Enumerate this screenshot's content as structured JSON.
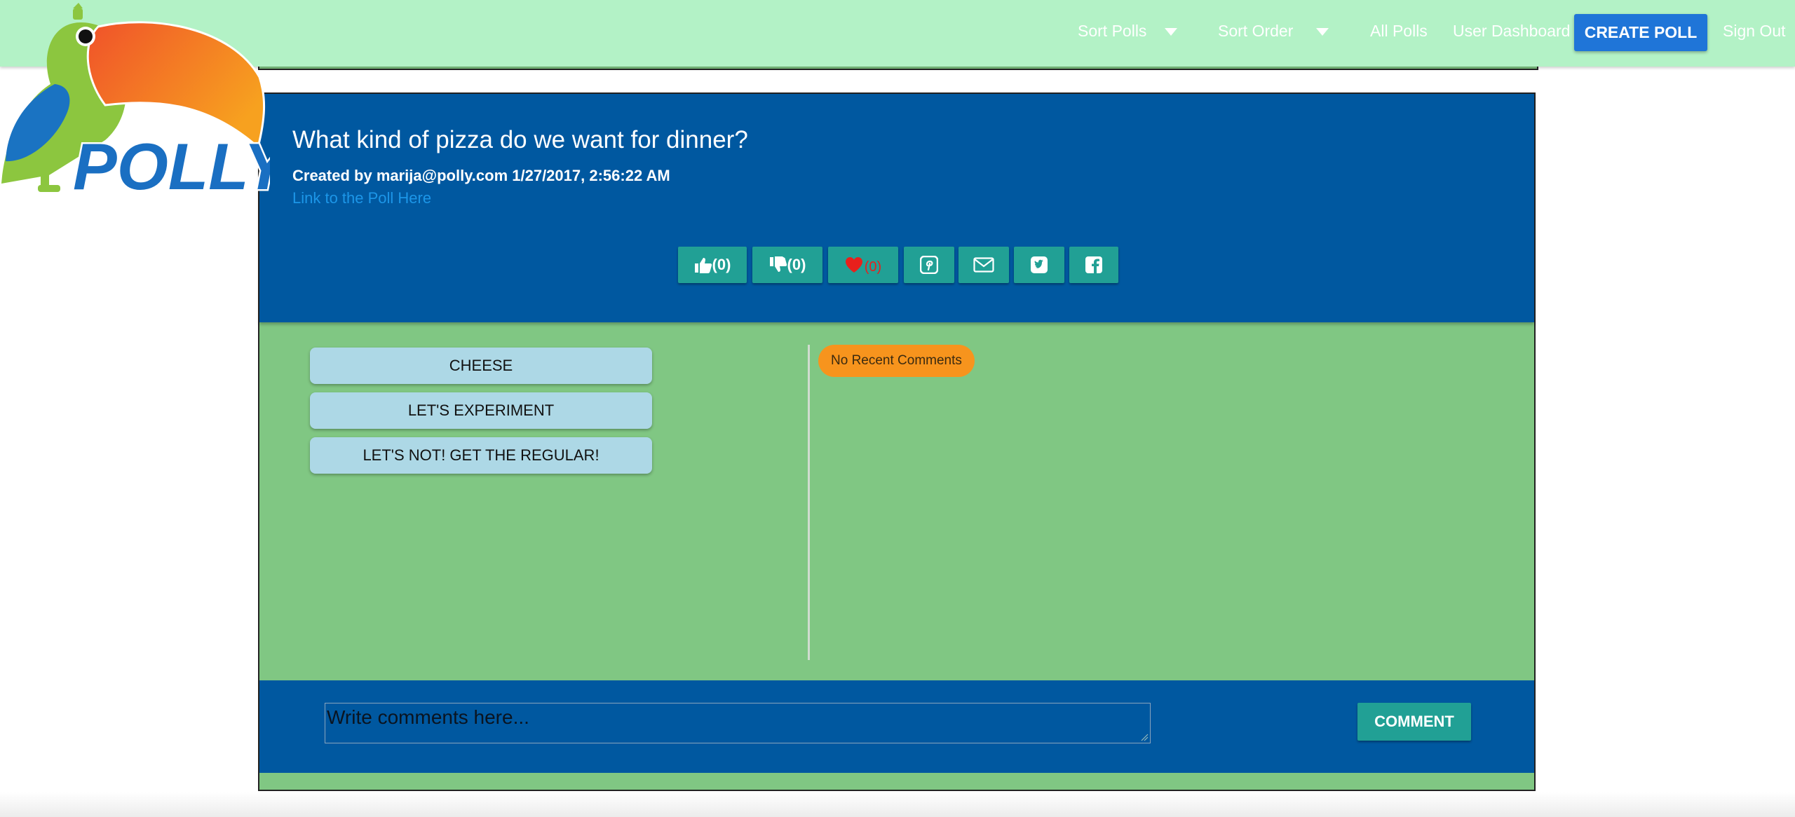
{
  "brand": {
    "logo_text": "POLLY"
  },
  "nav": {
    "sort_polls": "Sort Polls",
    "sort_order": "Sort Order",
    "all_polls": "All Polls",
    "user_dashboard": "User Dashboard",
    "create_poll": "CREATE POLL",
    "sign_out": "Sign Out"
  },
  "poll": {
    "question": "What kind of pizza do we want for dinner?",
    "created_by": "Created by marija@polly.com 1/27/2017, 2:56:22 AM",
    "link_text": "Link to the Poll Here",
    "likes": "(0)",
    "dislikes": "(0)",
    "favorites": "(0)",
    "options": [
      "Cheese",
      "Let's Experiment",
      "Let's not! Get the regular!"
    ]
  },
  "comments": {
    "empty_text": "No Recent Comments",
    "placeholder": "Write comments here...",
    "submit_label": "COMMENT"
  },
  "colors": {
    "nav_bg": "#b3f2c6",
    "header_blue": "#0058a0",
    "card_green": "#80c783",
    "teal": "#21a095",
    "option_bg": "#add8e6",
    "badge_orange": "#f7941d",
    "create_blue": "#1f75d8"
  },
  "icons": [
    "thumbs-up-icon",
    "thumbs-down-icon",
    "heart-icon",
    "pinterest-icon",
    "envelope-icon",
    "twitter-icon",
    "facebook-icon",
    "caret-down-icon"
  ]
}
